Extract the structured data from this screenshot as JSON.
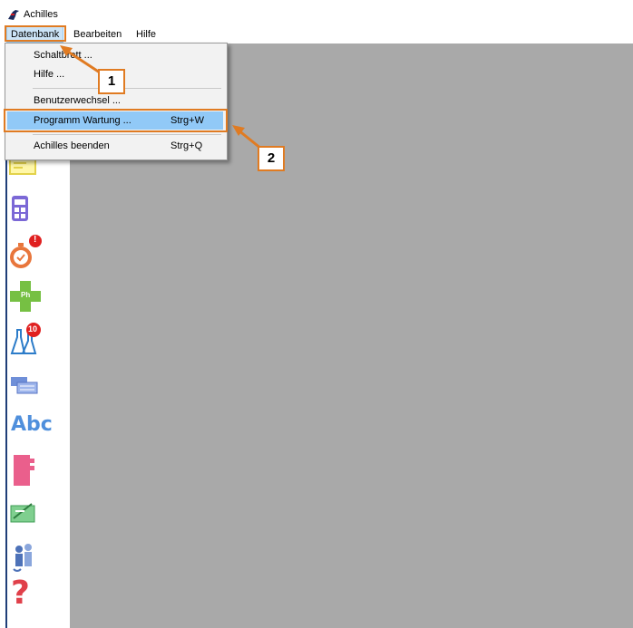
{
  "window": {
    "title": "Achilles",
    "app_icon": "achilles-logo-icon"
  },
  "menubar": {
    "items": [
      "Datenbank",
      "Bearbeiten",
      "Hilfe"
    ]
  },
  "dropdown": {
    "items": [
      {
        "label": "Schaltbrett ...",
        "shortcut": ""
      },
      {
        "label": "Hilfe ...",
        "shortcut": ""
      },
      {
        "label": "Benutzerwechsel ...",
        "shortcut": ""
      },
      {
        "label": "Programm Wartung ...",
        "shortcut": "Strg+W",
        "selected": true
      },
      {
        "label": "Achilles beenden",
        "shortcut": "Strg+Q"
      }
    ]
  },
  "callouts": {
    "one": "1",
    "two": "2"
  },
  "toolbar": {
    "buttons": [
      {
        "icon": "note-card-icon"
      },
      {
        "icon": "calculator-icon"
      },
      {
        "icon": "stopwatch-alert-icon",
        "badge": "!"
      },
      {
        "icon": "pharmacy-cross-icon",
        "label": "Ph"
      },
      {
        "icon": "lab-flasks-icon",
        "badge": "10"
      },
      {
        "icon": "message-windows-icon"
      },
      {
        "icon": "spelling-abc-icon",
        "label": "Abc"
      },
      {
        "icon": "pink-binder-icon"
      },
      {
        "icon": "signature-board-icon"
      },
      {
        "icon": "people-icon"
      },
      {
        "icon": "help-question-icon",
        "label": "?"
      }
    ]
  },
  "colors": {
    "accent_orange": "#e07b22",
    "workspace": "#a9a9a9",
    "selection": "#91c9f7",
    "toolbar_strip": "#1f3e78"
  }
}
